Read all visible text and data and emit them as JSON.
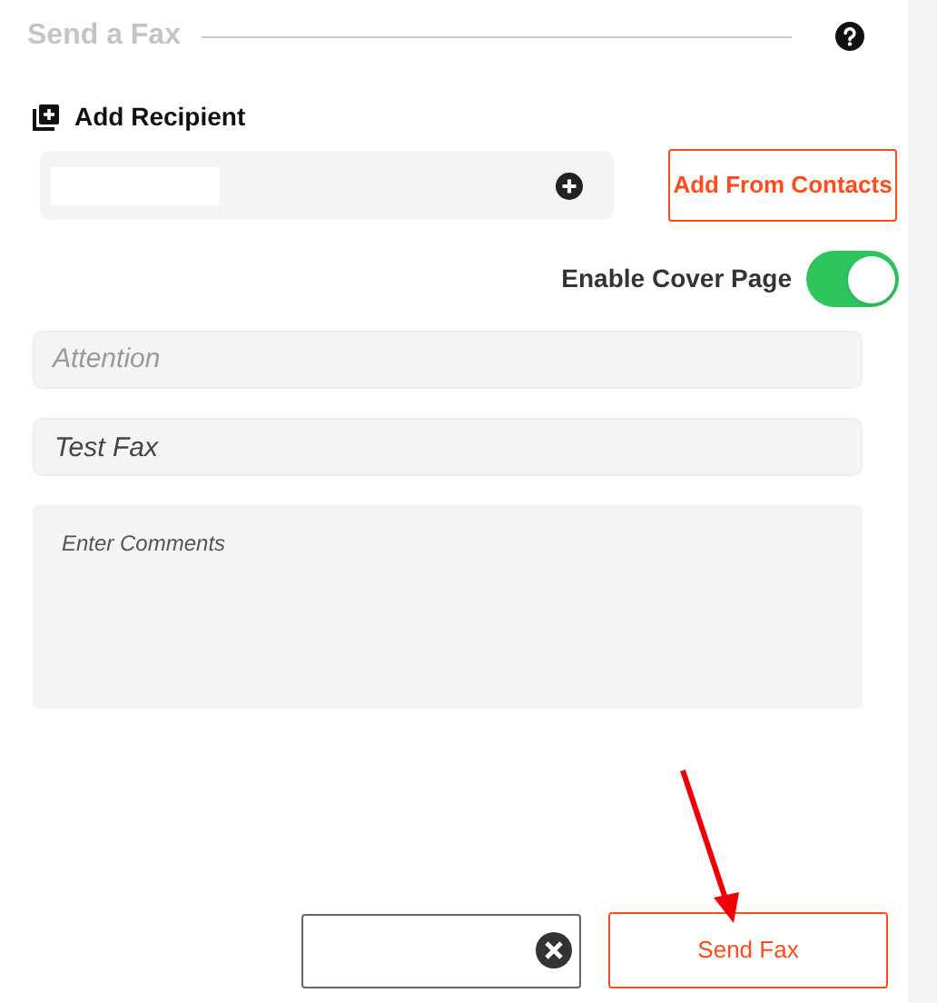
{
  "header": {
    "title": "Send a Fax"
  },
  "recipient": {
    "label": "Add Recipient",
    "add_from_contacts": "Add From Contacts"
  },
  "cover_page": {
    "label": "Enable Cover Page",
    "on": true
  },
  "attention": {
    "placeholder": "Attention"
  },
  "subject": {
    "value": "Test Fax"
  },
  "comments": {
    "placeholder": "Enter Comments"
  },
  "footer": {
    "send": "Send Fax"
  }
}
